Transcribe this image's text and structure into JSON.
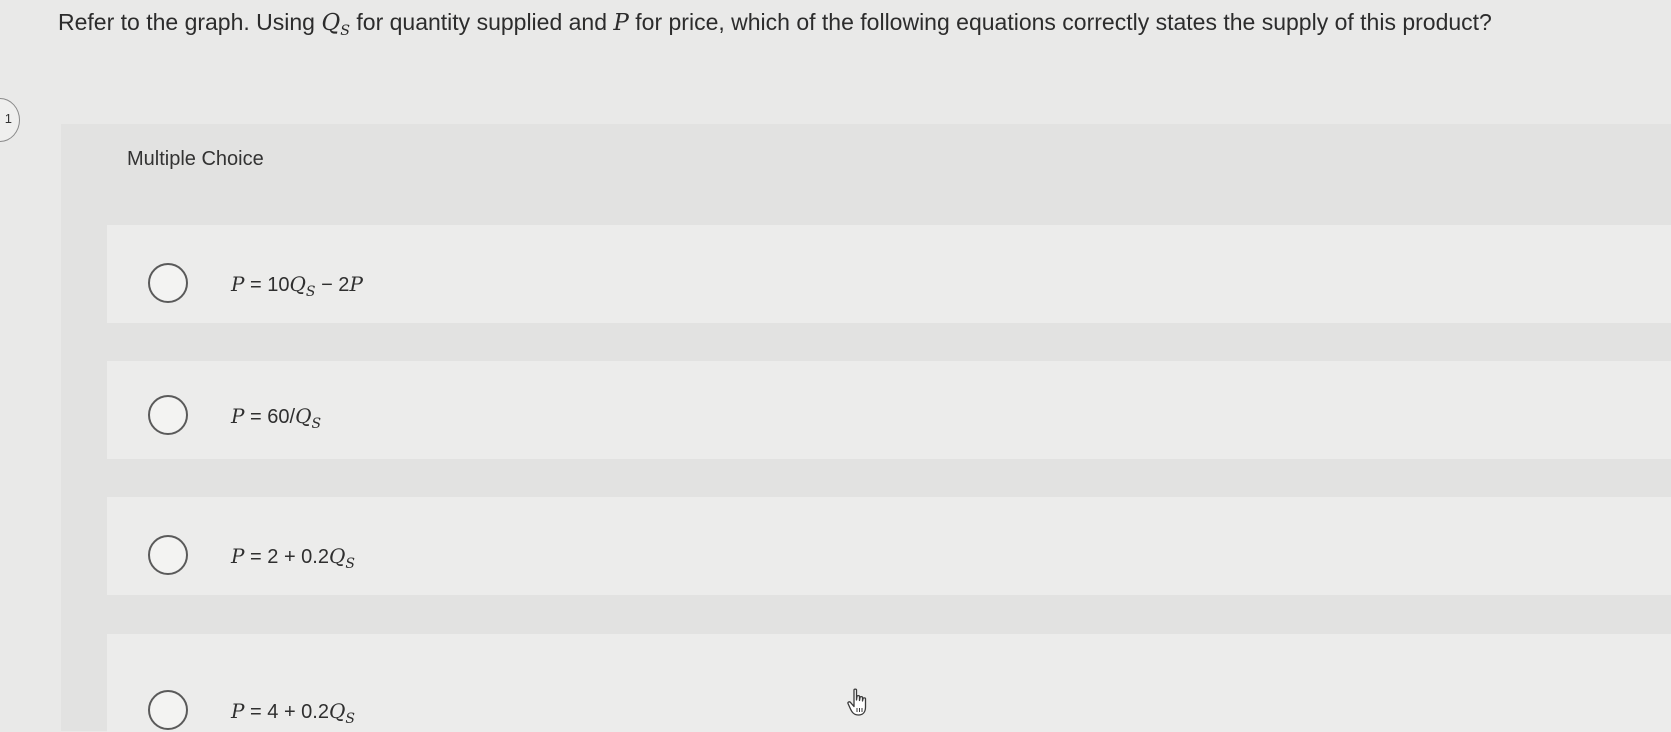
{
  "question": {
    "prefix": "Refer to the graph. Using ",
    "qs_symbol": "Q",
    "qs_subscript": "S",
    "middle": " for quantity supplied and ",
    "p_symbol": "P",
    "suffix": " for price, which of the following equations correctly states the supply of this product?"
  },
  "question_number": "1",
  "multiple_choice_label": "Multiple Choice",
  "options": [
    {
      "lhs": "P",
      "eq": " = 10",
      "var": "Q",
      "sub": "S",
      "tail": " − 2",
      "tail_var": "P"
    },
    {
      "lhs": "P",
      "eq": " = 60/",
      "var": "Q",
      "sub": "S",
      "tail": "",
      "tail_var": ""
    },
    {
      "lhs": "P",
      "eq": " = 2 + 0.2",
      "var": "Q",
      "sub": "S",
      "tail": "",
      "tail_var": ""
    },
    {
      "lhs": "P",
      "eq": " = 4 + 0.2",
      "var": "Q",
      "sub": "S",
      "tail": "",
      "tail_var": ""
    }
  ],
  "icons": {
    "cursor": "hand-pointer-icon",
    "radio": "radio-circle-icon"
  },
  "colors": {
    "page_bg": "#e9e9e8",
    "panel_bg": "#e2e2e1",
    "option_bg": "#ececeb",
    "radio_border": "#5a5a5a"
  }
}
